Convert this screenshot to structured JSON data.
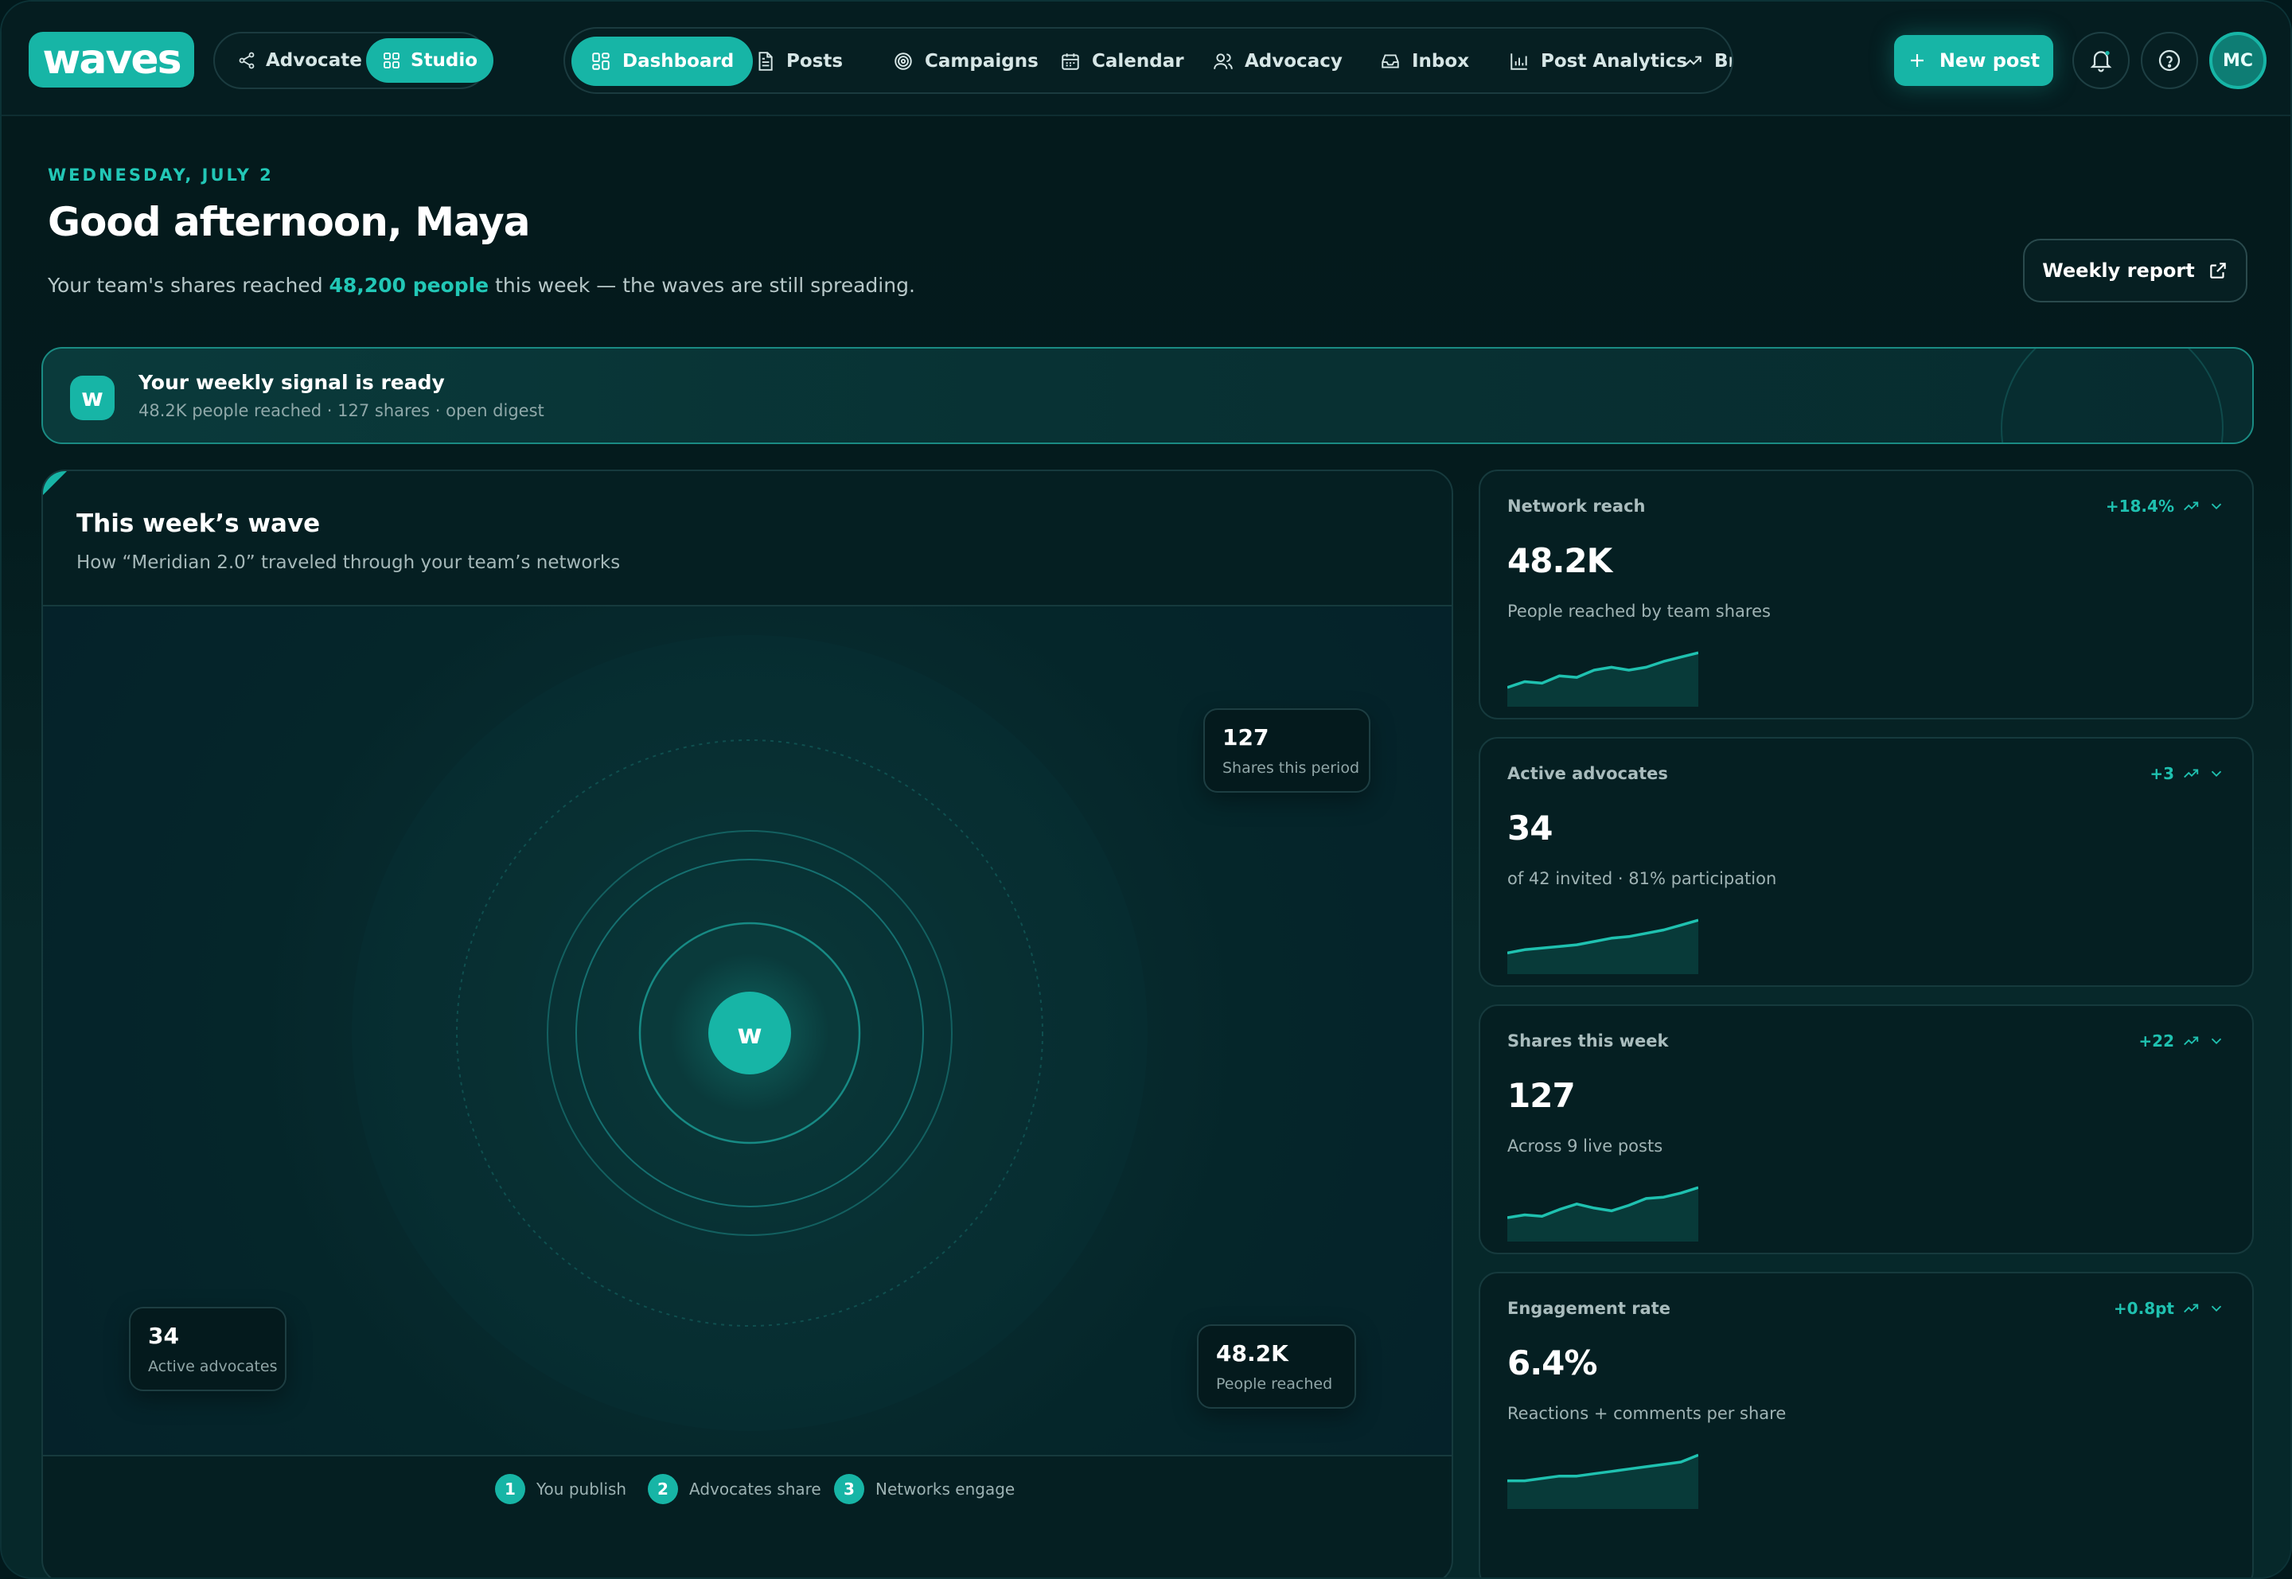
{
  "app": {
    "logo": "waves",
    "modes": [
      {
        "label": "Advocate",
        "icon": "share-icon",
        "active": false
      },
      {
        "label": "Studio",
        "icon": "grid-icon",
        "active": true
      }
    ],
    "nav": [
      {
        "label": "Dashboard",
        "icon": "dashboard-icon",
        "active": true
      },
      {
        "label": "Posts",
        "icon": "document-icon"
      },
      {
        "label": "Campaigns",
        "icon": "target-icon"
      },
      {
        "label": "Calendar",
        "icon": "calendar-icon"
      },
      {
        "label": "Advocacy",
        "icon": "users-icon"
      },
      {
        "label": "Inbox",
        "icon": "inbox-icon"
      },
      {
        "label": "Post Analytics",
        "icon": "bar-chart-icon"
      },
      {
        "label": "Brar",
        "icon": "trend-icon"
      }
    ],
    "new_post": "New post",
    "avatar_initials": "MC",
    "accent": "#17b5a6"
  },
  "hero": {
    "date": "WEDNESDAY, JULY 2",
    "greeting": "Good afternoon, Maya",
    "sub_prefix": "Your team's shares reached ",
    "sub_highlight": "48,200 people",
    "sub_suffix": " this week — the waves are still spreading.",
    "weekly_report": "Weekly report"
  },
  "signal": {
    "logo": "w",
    "title": "Your weekly signal is ready",
    "subtitle": "48.2K people reached · 127 shares · open digest"
  },
  "wave": {
    "title": "This week’s wave",
    "subtitle": "How “Meridian 2.0” traveled through your team’s networks",
    "center_logo": "w",
    "chips": [
      {
        "value": "127",
        "label": "Shares this period"
      },
      {
        "value": "34",
        "label": "Active advocates"
      },
      {
        "value": "48.2K",
        "label": "People reached"
      }
    ],
    "steps": [
      {
        "num": "1",
        "label": "You publish"
      },
      {
        "num": "2",
        "label": "Advocates share"
      },
      {
        "num": "3",
        "label": "Networks engage"
      }
    ]
  },
  "metrics": [
    {
      "title": "Network reach",
      "delta": "+18.4%",
      "value": "48.2K",
      "desc": "People reached by team shares",
      "spark": [
        10,
        14,
        13,
        18,
        17,
        22,
        24,
        22,
        24,
        28,
        31,
        34
      ]
    },
    {
      "title": "Active advocates",
      "delta": "+3",
      "value": "34",
      "desc": "of 42 invited · 81% participation",
      "spark": [
        10,
        12,
        13,
        14,
        15,
        17,
        19,
        20,
        22,
        24,
        27,
        30
      ]
    },
    {
      "title": "Shares this week",
      "delta": "+22",
      "value": "127",
      "desc": "Across 9 live posts",
      "spark": [
        14,
        16,
        15,
        20,
        24,
        21,
        19,
        23,
        28,
        29,
        32,
        36
      ]
    },
    {
      "title": "Engagement rate",
      "delta": "+0.8pt",
      "value": "6.4%",
      "desc": "Reactions + comments per share",
      "spark": [
        10,
        10,
        11,
        12,
        12,
        13,
        14,
        15,
        16,
        17,
        18,
        21
      ]
    }
  ]
}
